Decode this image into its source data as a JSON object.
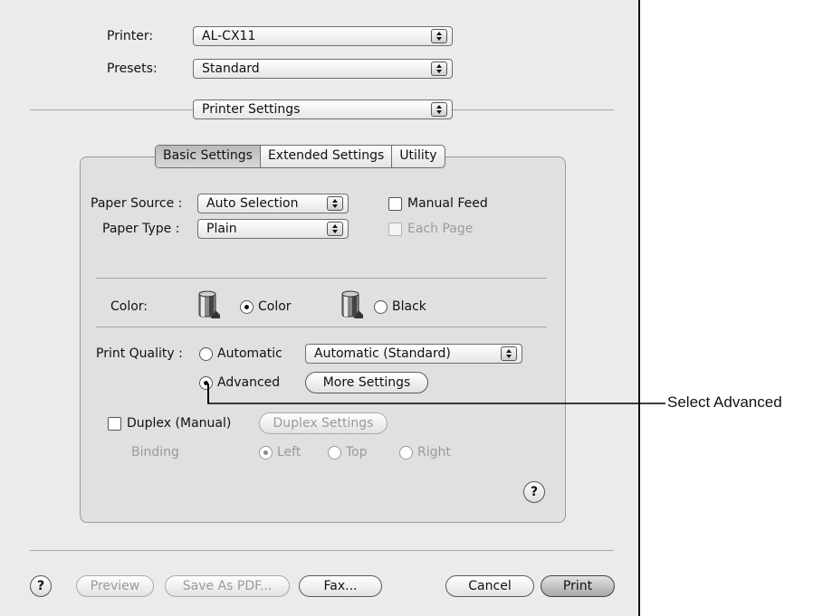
{
  "printer": {
    "label": "Printer:",
    "value": "AL-CX11"
  },
  "presets": {
    "label": "Presets:",
    "value": "Standard"
  },
  "panel_menu": {
    "value": "Printer Settings"
  },
  "tabs": [
    {
      "label": "Basic Settings",
      "selected": true
    },
    {
      "label": "Extended Settings",
      "selected": false
    },
    {
      "label": "Utility",
      "selected": false
    }
  ],
  "paper_source": {
    "label": "Paper Source :",
    "value": "Auto Selection"
  },
  "paper_type": {
    "label": "Paper Type :",
    "value": "Plain"
  },
  "manual_feed": {
    "label": "Manual Feed",
    "checked": false
  },
  "each_page": {
    "label": "Each Page",
    "checked": false,
    "enabled": false
  },
  "color": {
    "label": "Color:",
    "options": [
      {
        "label": "Color",
        "selected": true
      },
      {
        "label": "Black",
        "selected": false
      }
    ]
  },
  "print_quality": {
    "label": "Print Quality :",
    "automatic_label": "Automatic",
    "automatic_value": "Automatic (Standard)",
    "advanced_label": "Advanced",
    "more_settings": "More Settings",
    "selected": "Advanced"
  },
  "duplex": {
    "label": "Duplex (Manual)",
    "checked": false,
    "settings_button": "Duplex Settings"
  },
  "binding": {
    "label": "Binding",
    "options": [
      {
        "label": "Left",
        "selected": true
      },
      {
        "label": "Top",
        "selected": false
      },
      {
        "label": "Right",
        "selected": false
      }
    ]
  },
  "buttons": {
    "help": "?",
    "preview": "Preview",
    "save_pdf": "Save As PDF...",
    "fax": "Fax...",
    "cancel": "Cancel",
    "print": "Print"
  },
  "callout": {
    "text": "Select Advanced"
  }
}
